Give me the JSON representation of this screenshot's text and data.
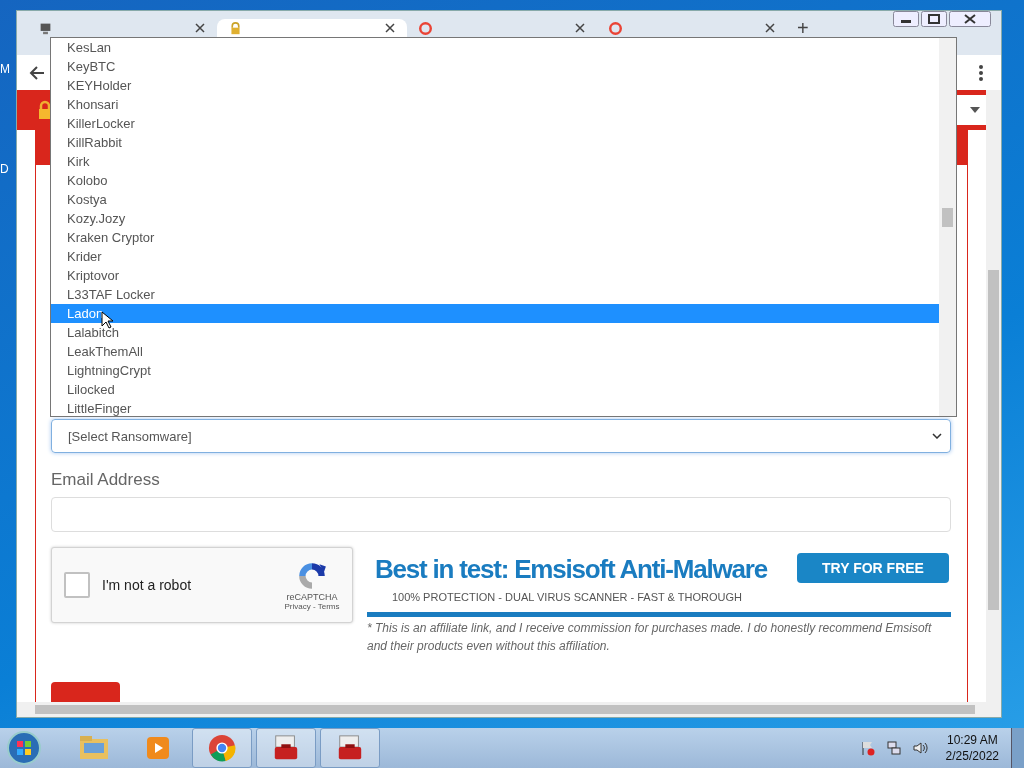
{
  "desktop_labels": [
    "M",
    "D"
  ],
  "browser": {
    "tabs": [
      {
        "kind": "computer",
        "selected": false
      },
      {
        "kind": "lock",
        "selected": true
      },
      {
        "kind": "google",
        "selected": false
      },
      {
        "kind": "google",
        "selected": false
      }
    ],
    "new_tab": "+"
  },
  "dropdown": {
    "items": [
      {
        "label": "KesLan",
        "selected": false
      },
      {
        "label": "KeyBTC",
        "selected": false
      },
      {
        "label": "KEYHolder",
        "selected": false
      },
      {
        "label": "Khonsari",
        "selected": false
      },
      {
        "label": "KillerLocker",
        "selected": false
      },
      {
        "label": "KillRabbit",
        "selected": false
      },
      {
        "label": "Kirk",
        "selected": false
      },
      {
        "label": "Kolobo",
        "selected": false
      },
      {
        "label": "Kostya",
        "selected": false
      },
      {
        "label": "Kozy.Jozy",
        "selected": false
      },
      {
        "label": "Kraken Cryptor",
        "selected": false
      },
      {
        "label": "Krider",
        "selected": false
      },
      {
        "label": "Kriptovor",
        "selected": false
      },
      {
        "label": "L33TAF Locker",
        "selected": false
      },
      {
        "label": "Ladon",
        "selected": true
      },
      {
        "label": "Lalabitch",
        "selected": false
      },
      {
        "label": "LeakThemAll",
        "selected": false
      },
      {
        "label": "LightningCrypt",
        "selected": false
      },
      {
        "label": "Lilocked",
        "selected": false
      },
      {
        "label": "LittleFinger",
        "selected": false
      }
    ]
  },
  "form": {
    "ransomware_select": "[Select Ransomware]",
    "email_label": "Email Address",
    "captcha": {
      "label": "I'm not a robot",
      "checked": false,
      "brand": "reCAPTCHA",
      "links": "Privacy - Terms"
    }
  },
  "ad": {
    "headline": "Best in test: Emsisoft Anti-Malware",
    "button": "TRY FOR FREE",
    "tagline": "100% PROTECTION - DUAL VIRUS SCANNER - FAST & THOROUGH",
    "note": "* This is an affiliate link, and I receive commission for purchases made. I do honestly recommend Emsisoft and their products even without this affiliation."
  },
  "taskbar": {
    "apps": [
      {
        "kind": "folder",
        "active": false
      },
      {
        "kind": "media",
        "active": false
      },
      {
        "kind": "chrome",
        "active": true
      },
      {
        "kind": "toolbox",
        "active": true
      },
      {
        "kind": "toolbox",
        "active": true
      }
    ],
    "time": "10:29 AM",
    "date": "2/25/2022"
  }
}
